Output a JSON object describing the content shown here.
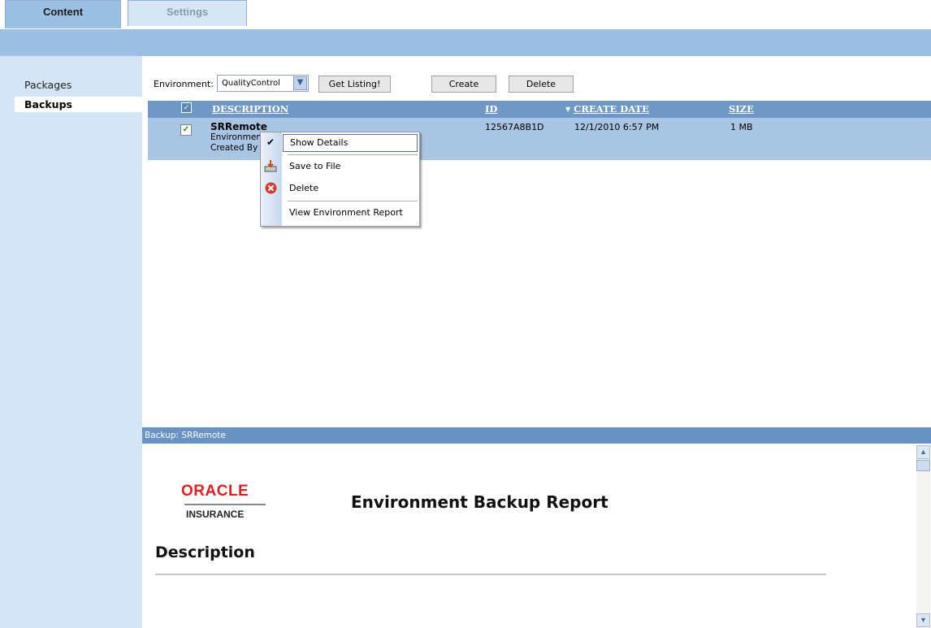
{
  "tabs": [
    {
      "label": "Content",
      "active": true
    },
    {
      "label": "Settings",
      "active": false
    }
  ],
  "sidebar": {
    "items": [
      {
        "label": "Packages",
        "selected": false
      },
      {
        "label": "Backups",
        "selected": true
      }
    ]
  },
  "toolbar": {
    "environment_label": "Environment:",
    "environment_value": "QualityControl",
    "get_listing_label": "Get Listing!",
    "create_label": "Create",
    "delete_label": "Delete"
  },
  "table": {
    "columns": [
      {
        "label": "DESCRIPTION"
      },
      {
        "label": "ID"
      },
      {
        "label": "▼ CREATE DATE"
      },
      {
        "label": "SIZE"
      }
    ],
    "rows": [
      {
        "checked": true,
        "title": "SRRemote",
        "line2": "Environment",
        "line3": "Created By",
        "id": "12567A8B1D",
        "create_date": "12/1/2010 6:57 PM",
        "size": "1 MB"
      }
    ]
  },
  "context_menu": {
    "items": [
      {
        "label": "Show Details",
        "icon": "checkmark-icon",
        "highlighted": true
      },
      {
        "label": "Save to File",
        "icon": "save-to-file-icon"
      },
      {
        "label": "Delete",
        "icon": "delete-red-x-icon"
      },
      {
        "label": "View Environment Report",
        "icon": ""
      }
    ]
  },
  "detail_panel": {
    "header": "Backup: SRRemote",
    "logo_oracle": "ORACLE",
    "logo_insurance": "INSURANCE",
    "report_title": "Environment Backup Report",
    "section_heading": "Description"
  },
  "colors": {
    "tab_active": "#9cc0e4",
    "band": "#9cc0e4",
    "sidebar": "#d4e5f6",
    "table_header": "#6f98c5",
    "row_selected": "#a9c5e4",
    "oracle_red": "#e02020"
  }
}
